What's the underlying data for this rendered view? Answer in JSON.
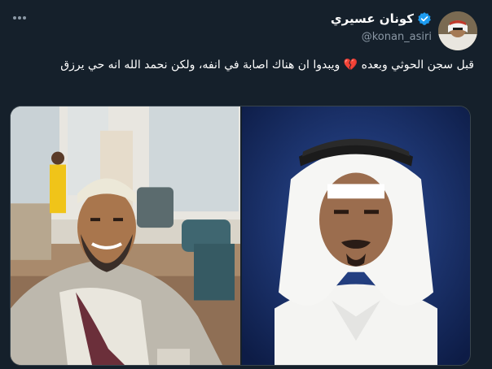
{
  "tweet": {
    "display_name": "كونان عسيري",
    "handle": "@konan_asiri",
    "text": "قبل سجن الحوثي وبعده 💔 ويبدوا ان هناك اصابة في انفه، ولكن نحمد الله انه حي يرزق",
    "verified": true
  },
  "media": {
    "images": [
      {
        "description_name": "photo-before"
      },
      {
        "description_name": "photo-after"
      }
    ]
  },
  "colors": {
    "background": "#15202b",
    "secondary_text": "#8b98a5",
    "verified_blue": "#1d9bf0",
    "border": "#38444d"
  },
  "icons": {
    "more": "more-horizontal-icon",
    "verified": "verified-badge-icon"
  }
}
